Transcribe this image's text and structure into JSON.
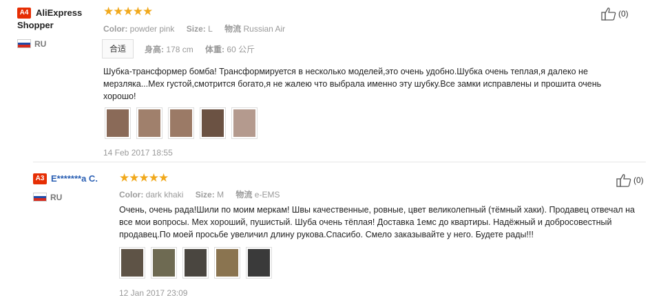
{
  "reviews": [
    {
      "badge": "A4",
      "user": "AliExpress Shopper",
      "country": "RU",
      "stars": "★★★★★",
      "props": [
        {
          "k": "Color:",
          "v": "powder pink"
        },
        {
          "k": "Size:",
          "v": "L"
        },
        {
          "k": "物流",
          "v": "Russian Air"
        }
      ],
      "fit_label": "合适",
      "height_label": "身高:",
      "height_value": "178 cm",
      "weight_label": "体重:",
      "weight_value": "60 公斤",
      "text": "Шубка-трансформер бомба! Трансформируется в несколько моделей,это очень удобно.Шубка очень теплая,я далеко не мерзляка...Мех густой,смотрится богато,я не жалею что выбрала именно эту шубку.Все замки исправлены и прошита очень хорошо!",
      "date": "14 Feb 2017 18:55",
      "likes": "(0)",
      "thumb_colors": [
        "#8a6a58",
        "#a0806c",
        "#9b7a66",
        "#6b5243",
        "#b49a8e"
      ]
    },
    {
      "badge": "A3",
      "user": "E*******a C.",
      "country": "RU",
      "stars": "★★★★★",
      "props": [
        {
          "k": "Color:",
          "v": "dark khaki"
        },
        {
          "k": "Size:",
          "v": "M"
        },
        {
          "k": "物流",
          "v": "e-EMS"
        }
      ],
      "text": "Очень, очень рада!Шили по моим меркам! Швы качественные, ровные, цвет великолепный (тёмный хаки). Продавец отвечал на все мои вопросы. Мех хороший, пушистый. Шуба очень тёплая! Доставка 1емс до квартиры. Надёжный и добросовестный продавец.По моей просьбе увеличил длину рукова.Спасибо. Смело заказывайте у него. Будете рады!!!",
      "date": "12 Jan 2017 23:09",
      "likes": "(0)",
      "thumb_colors": [
        "#5e5346",
        "#6e6a52",
        "#4a4640",
        "#8a7450",
        "#3a3a3a"
      ]
    }
  ],
  "colors": {
    "badge": "#e62e04",
    "star": "#f1a91d",
    "flag_white": "#ffffff",
    "flag_blue": "#1f4aa8",
    "flag_red": "#d52b1e"
  }
}
